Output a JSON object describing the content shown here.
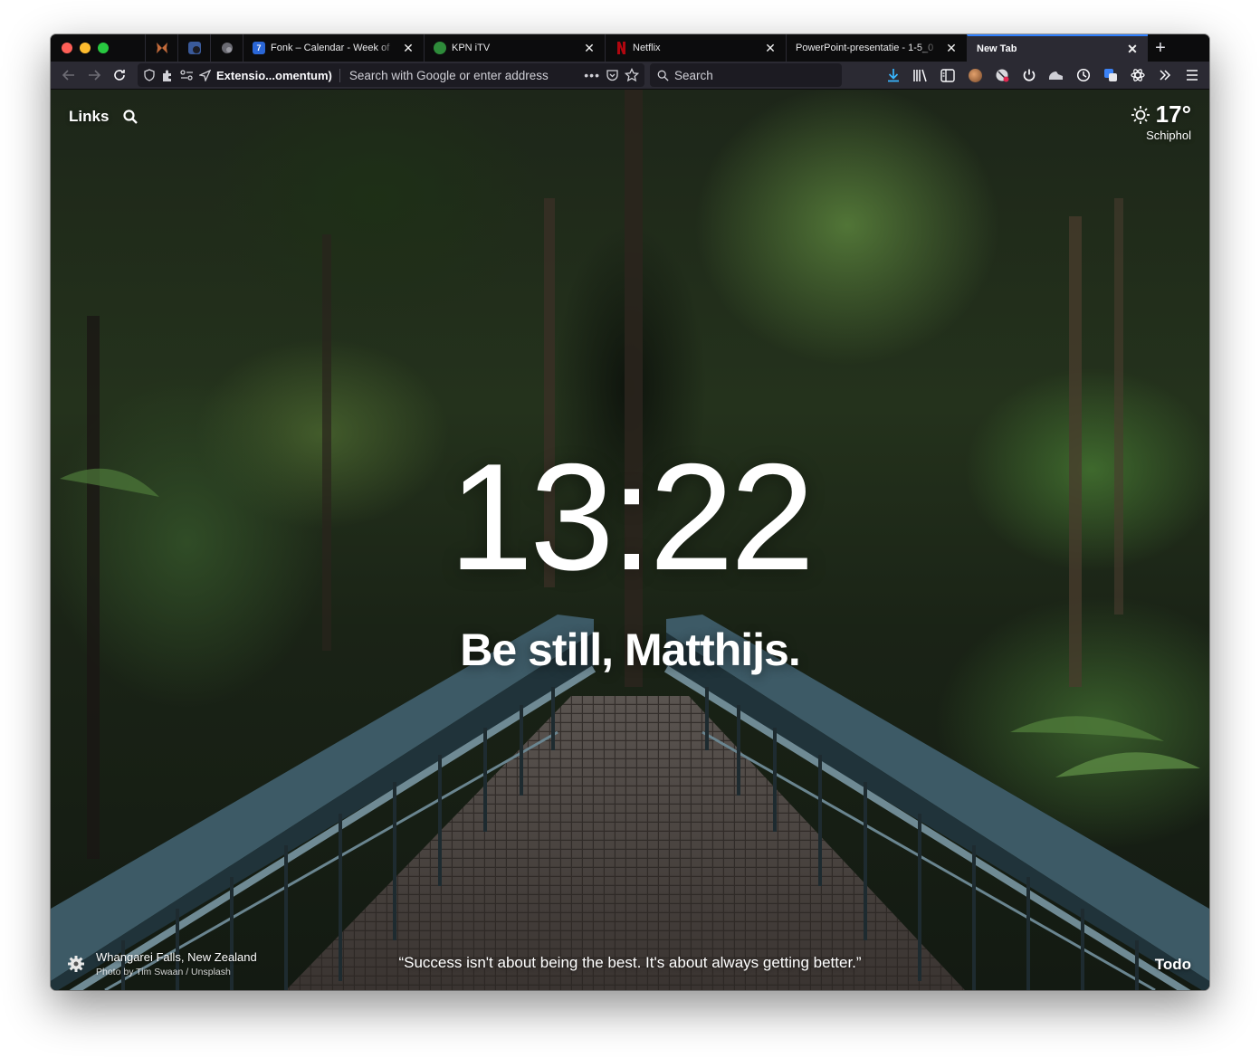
{
  "tabs": {
    "pinned": [
      {
        "icon": "butterfly-icon",
        "color": "#c26a3a"
      },
      {
        "icon": "app-icon",
        "color": "#3a5a9a"
      },
      {
        "icon": "shell-icon",
        "color": "#6a6a72"
      }
    ],
    "items": [
      {
        "title": "Fonk – Calendar - Week of",
        "favicon": "calendar-icon",
        "favicon_text": "7",
        "color": "#2a66d6",
        "close": "✕"
      },
      {
        "title": "KPN iTV",
        "favicon": "kpn-icon",
        "favicon_text": "",
        "color": "#2e8b3a",
        "close": "✕"
      },
      {
        "title": "Netflix",
        "favicon": "netflix-icon",
        "favicon_text": "",
        "color": "#b0060f",
        "close": "✕"
      },
      {
        "title": "PowerPoint-presentatie - 1-5_0",
        "favicon": "",
        "favicon_text": "",
        "color": "",
        "close": "✕"
      },
      {
        "title": "New Tab",
        "favicon": "",
        "favicon_text": "",
        "color": "",
        "close": "✕"
      }
    ],
    "new_tab": "+"
  },
  "navbar": {
    "extension_label": "Extensio...omentum)",
    "url_placeholder": "Search with Google or enter address",
    "url_more": "•••",
    "search_placeholder": "Search"
  },
  "colors": {
    "accent": "#2f80ff",
    "download": "#38b6ff"
  },
  "page": {
    "links": "Links",
    "clock": "13:22",
    "greeting": "Be still, Matthijs.",
    "weather": {
      "temperature": "17°",
      "location": "Schiphol",
      "icon": "sun-icon"
    },
    "photo": {
      "location": "Whangarei Falls, New Zealand",
      "credit": "Photo by Tim Swaan / Unsplash"
    },
    "quote": "“Success isn't about being the best. It's about always getting better.”",
    "todo": "Todo"
  }
}
